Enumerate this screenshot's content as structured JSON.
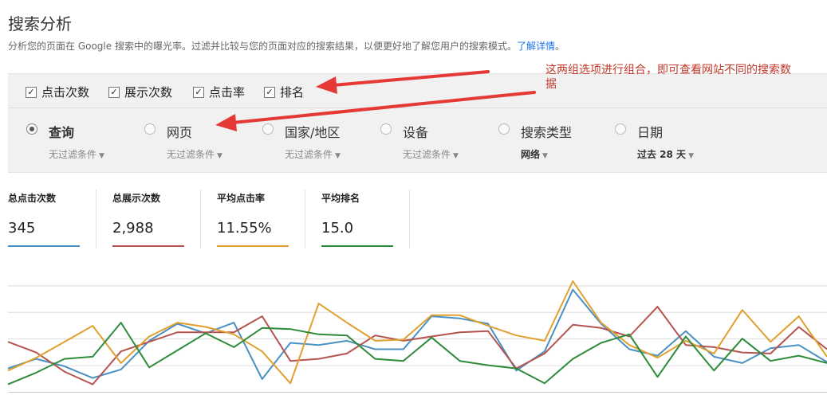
{
  "header": {
    "title": "搜索分析",
    "subtitle": "分析您的页面在 Google 搜索中的曝光率。过滤并比较与您的页面对应的搜索结果，以便更好地了解您用户的搜索模式。",
    "learn_more": "了解详情",
    "period": "。"
  },
  "metric_checkboxes": [
    {
      "label": "点击次数",
      "checked": true
    },
    {
      "label": "展示次数",
      "checked": true
    },
    {
      "label": "点击率",
      "checked": true
    },
    {
      "label": "排名",
      "checked": true
    }
  ],
  "dimensions": [
    {
      "label": "查询",
      "selected": true,
      "filter": "无过滤条件"
    },
    {
      "label": "网页",
      "selected": false,
      "filter": "无过滤条件"
    },
    {
      "label": "国家/地区",
      "selected": false,
      "filter": "无过滤条件"
    },
    {
      "label": "设备",
      "selected": false,
      "filter": "无过滤条件"
    },
    {
      "label": "搜索类型",
      "selected": false,
      "filter": "网络"
    },
    {
      "label": "日期",
      "selected": false,
      "filter": "过去 28 天"
    }
  ],
  "annotation": {
    "line1": "这两组选项进行组合，即可查看网站不同的搜索数",
    "line2": "据"
  },
  "summary": [
    {
      "label": "总点击次数",
      "value": "345",
      "color": "#4a90c2"
    },
    {
      "label": "总展示次数",
      "value": "2,988",
      "color": "#b5544f"
    },
    {
      "label": "平均点击率",
      "value": "11.55%",
      "color": "#e0a030"
    },
    {
      "label": "平均排名",
      "value": "15.0",
      "color": "#2e8b3a"
    }
  ],
  "colors": {
    "clicks": "#4a90c2",
    "impressions": "#b5544f",
    "ctr": "#e0a030",
    "position": "#2e8b3a",
    "annotation": "#c0392b",
    "link": "#1a73e8"
  },
  "chart_data": {
    "type": "line",
    "x": [
      1,
      2,
      3,
      4,
      5,
      6,
      7,
      8,
      9,
      10,
      11,
      12,
      13,
      14,
      15,
      16,
      17,
      18,
      19,
      20,
      21,
      22,
      23,
      24,
      25,
      26,
      27,
      28,
      29,
      30
    ],
    "series": [
      {
        "key": "clicks",
        "values": [
          22,
          31,
          24,
          13,
          21,
          48,
          64,
          55,
          65,
          12,
          46,
          44,
          48,
          40,
          40,
          71,
          69,
          64,
          20,
          38,
          96,
          64,
          40,
          34,
          57,
          33,
          27,
          41,
          44,
          28
        ]
      },
      {
        "key": "impressions",
        "values": [
          47,
          37,
          19,
          7,
          38,
          47,
          56,
          56,
          56,
          71,
          29,
          31,
          36,
          53,
          48,
          52,
          56,
          57,
          22,
          36,
          63,
          60,
          52,
          80,
          44,
          42,
          37,
          36,
          61,
          40
        ]
      },
      {
        "key": "ctr",
        "values": [
          20,
          32,
          47,
          62,
          27,
          52,
          65,
          61,
          54,
          38,
          8,
          83,
          65,
          48,
          49,
          72,
          72,
          62,
          53,
          48,
          104,
          65,
          44,
          32,
          48,
          36,
          77,
          47,
          71,
          33
        ]
      },
      {
        "key": "position",
        "values": [
          7,
          18,
          31,
          33,
          65,
          23,
          39,
          55,
          42,
          60,
          59,
          54,
          53,
          31,
          29,
          51,
          29,
          25,
          22,
          8,
          31,
          46,
          54,
          14,
          52,
          20,
          50,
          29,
          34,
          27
        ]
      }
    ],
    "ylim": [
      0,
      110
    ],
    "grid": true
  }
}
